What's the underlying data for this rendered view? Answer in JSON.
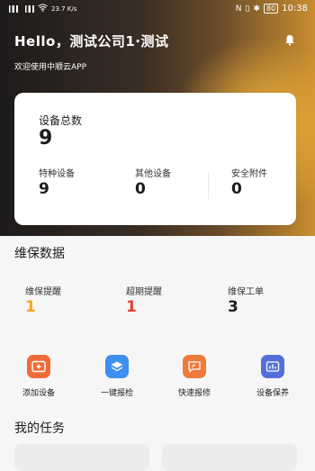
{
  "status_bar": {
    "left_text": "23.7 K/s",
    "time": "10:38",
    "battery": "80"
  },
  "header": {
    "greeting": "Hello，测试公司1·测试",
    "welcome": "欢迎使用中顺云APP",
    "notification_icon": "bell-icon"
  },
  "device_summary": {
    "total_label": "设备总数",
    "total_value": "9",
    "items": [
      {
        "label": "特种设备",
        "value": "9"
      },
      {
        "label": "其他设备",
        "value": "0"
      },
      {
        "label": "安全附件",
        "value": "0"
      }
    ]
  },
  "maintenance": {
    "title": "维保数据",
    "items": [
      {
        "label": "维保提醒",
        "value": "1",
        "color": "#f5a623"
      },
      {
        "label": "超期提醒",
        "value": "1",
        "color": "#e8412c"
      },
      {
        "label": "维保工单",
        "value": "3",
        "color": "#1c1c1c"
      }
    ]
  },
  "quick_actions": [
    {
      "label": "添加设备",
      "icon": "add-device-icon",
      "color": "#f06b3a"
    },
    {
      "label": "一键报检",
      "icon": "layers-icon",
      "color": "#3e8ef0"
    },
    {
      "label": "快速报修",
      "icon": "chat-icon",
      "color": "#f07a3a"
    },
    {
      "label": "设备保养",
      "icon": "chart-icon",
      "color": "#5470d8"
    }
  ],
  "tasks": {
    "title": "我的任务"
  }
}
